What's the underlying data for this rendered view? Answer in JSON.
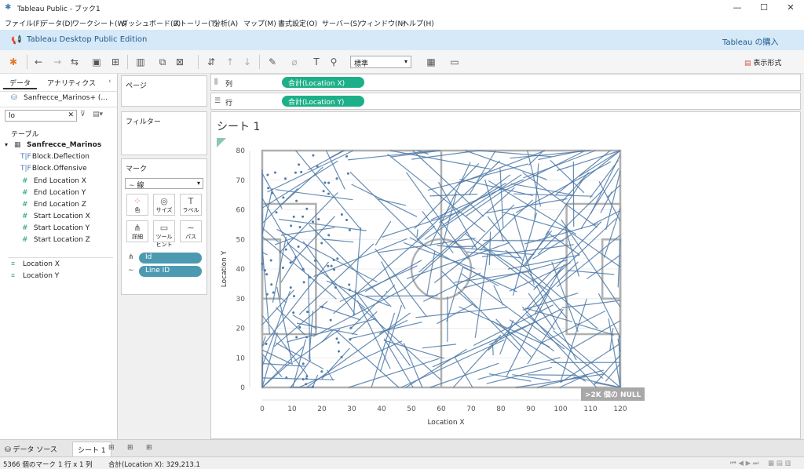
{
  "window": {
    "title": "Tableau Public - ブック1"
  },
  "menu": [
    "ファイル(F)",
    "データ(D)",
    "ワークシート(W)",
    "ダッシュボード(B)",
    "ストーリー(T)",
    "分析(A)",
    "マップ(M)",
    "書式設定(O)",
    "サーバー(S)",
    "ウィンドウ(N)",
    "ヘルプ(H)"
  ],
  "edition": {
    "label": "Tableau Desktop Public Edition",
    "buy": "Tableau の購入"
  },
  "toolbar": {
    "format_select": "標準",
    "show_me": "表示形式"
  },
  "data_pane": {
    "tabs": [
      "データ",
      "アナリティクス"
    ],
    "datasource": "Sanfrecce_Marinos+ (...",
    "search_value": "lo",
    "table_header": "テーブル",
    "table_name": "Sanfrecce_Marinos",
    "dimensions": [
      "Block.Deflection",
      "Block.Offensive"
    ],
    "measures_in_table": [
      "End Location X",
      "End Location Y",
      "End Location Z",
      "Start Location X",
      "Start Location Y",
      "Start Location Z"
    ],
    "generated": [
      "Location X",
      "Location Y"
    ]
  },
  "cards": {
    "pages": "ページ",
    "filters": "フィルター",
    "marks": "マーク",
    "mark_type": "線",
    "mark_buttons": [
      "色",
      "サイズ",
      "ラベル",
      "詳細",
      "ツールヒント",
      "パス"
    ],
    "mark_pills": [
      "Id",
      "Line ID"
    ]
  },
  "shelves": {
    "columns_label": "列",
    "columns_pill": "合計(Location X)",
    "rows_label": "行",
    "rows_pill": "合計(Location Y)"
  },
  "sheet": {
    "title": "シート 1",
    "null_badge": ">2K 個の NULL"
  },
  "chart_data": {
    "type": "line",
    "xlabel": "Location X",
    "ylabel": "Location Y",
    "xlim": [
      0,
      120
    ],
    "ylim": [
      0,
      80
    ],
    "x_ticks": [
      0,
      10,
      20,
      30,
      40,
      50,
      60,
      70,
      80,
      90,
      100,
      110,
      120
    ],
    "y_ticks": [
      0,
      10,
      20,
      30,
      40,
      50,
      60,
      70,
      80
    ],
    "series_color": "#4e79a7",
    "mark_count": 5366
  },
  "bottom_tabs": [
    "データ ソース",
    "シート 1"
  ],
  "status": {
    "marks": "5366 個のマーク",
    "rows_cols": "1 行 x 1 列",
    "sum": "合計(Location X): 329,213.1"
  },
  "colors": {
    "accent_green": "#1db088",
    "accent_blue": "#4b9ab1",
    "edition_bg": "#d6e9f8"
  }
}
